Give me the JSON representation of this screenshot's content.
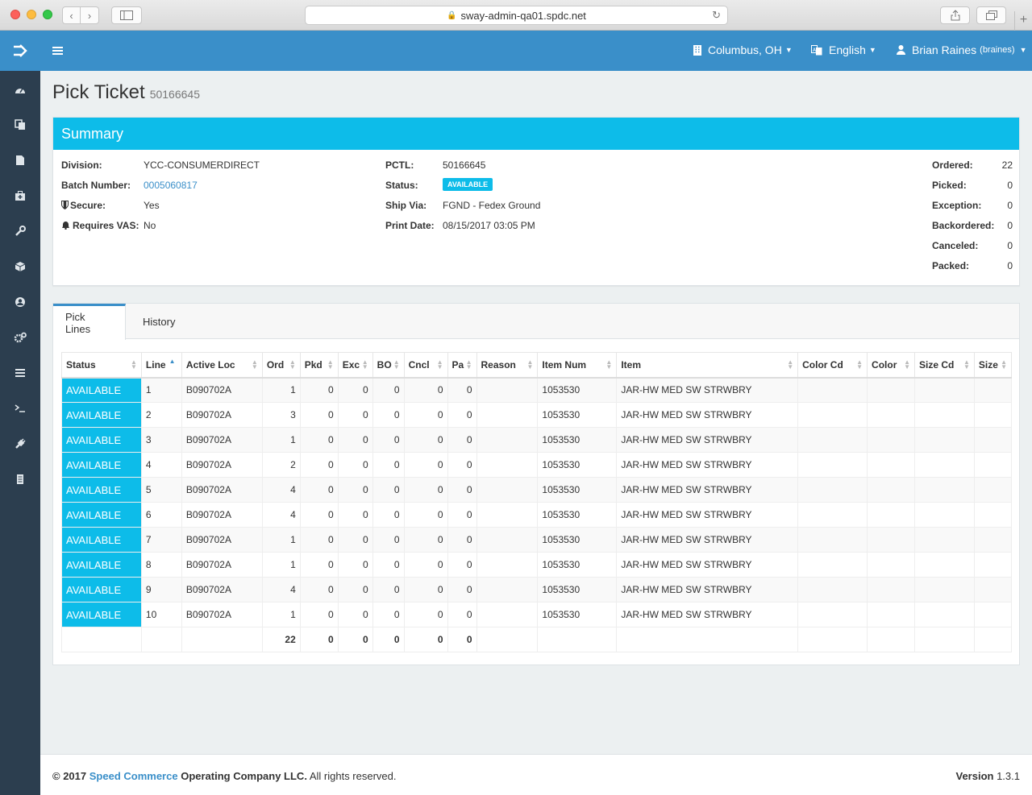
{
  "browser": {
    "url": "sway-admin-qa01.spdc.net"
  },
  "topnav": {
    "location": "Columbus, OH",
    "language": "English",
    "user_name": "Brian Raines",
    "user_login": "(braines)"
  },
  "page": {
    "title": "Pick Ticket",
    "ticket_id": "50166645"
  },
  "summary": {
    "heading": "Summary",
    "left": [
      {
        "label": "Division:",
        "value": "YCC-CONSUMERDIRECT"
      },
      {
        "label": "Batch Number:",
        "value": "0005060817"
      },
      {
        "label": "Secure:",
        "value": "Yes"
      },
      {
        "label": "Requires VAS:",
        "value": "No"
      }
    ],
    "middle": [
      {
        "label": "PCTL:",
        "value": "50166645"
      },
      {
        "label": "Status:",
        "value": "AVAILABLE"
      },
      {
        "label": "Ship Via:",
        "value": "FGND - Fedex Ground"
      },
      {
        "label": "Print Date:",
        "value": "08/15/2017 03:05 PM"
      }
    ],
    "right": [
      {
        "label": "Ordered:",
        "value": "22"
      },
      {
        "label": "Picked:",
        "value": "0"
      },
      {
        "label": "Exception:",
        "value": "0"
      },
      {
        "label": "Backordered:",
        "value": "0"
      },
      {
        "label": "Canceled:",
        "value": "0"
      },
      {
        "label": "Packed:",
        "value": "0"
      }
    ]
  },
  "tabs": [
    {
      "label": "Pick Lines",
      "active": true
    },
    {
      "label": "History",
      "active": false
    }
  ],
  "table": {
    "columns": [
      "Status",
      "Line",
      "Active Loc",
      "Ord",
      "Pkd",
      "Exc",
      "BO",
      "Cncl",
      "Pa",
      "Reason",
      "Item Num",
      "Item",
      "Color Cd",
      "Color",
      "Size Cd",
      "Size"
    ],
    "rows": [
      [
        "AVAILABLE",
        "1",
        "B090702A",
        "1",
        "0",
        "0",
        "0",
        "0",
        "0",
        "",
        "1053530",
        "JAR-HW MED SW STRWBRY",
        "",
        "",
        "",
        ""
      ],
      [
        "AVAILABLE",
        "2",
        "B090702A",
        "3",
        "0",
        "0",
        "0",
        "0",
        "0",
        "",
        "1053530",
        "JAR-HW MED SW STRWBRY",
        "",
        "",
        "",
        ""
      ],
      [
        "AVAILABLE",
        "3",
        "B090702A",
        "1",
        "0",
        "0",
        "0",
        "0",
        "0",
        "",
        "1053530",
        "JAR-HW MED SW STRWBRY",
        "",
        "",
        "",
        ""
      ],
      [
        "AVAILABLE",
        "4",
        "B090702A",
        "2",
        "0",
        "0",
        "0",
        "0",
        "0",
        "",
        "1053530",
        "JAR-HW MED SW STRWBRY",
        "",
        "",
        "",
        ""
      ],
      [
        "AVAILABLE",
        "5",
        "B090702A",
        "4",
        "0",
        "0",
        "0",
        "0",
        "0",
        "",
        "1053530",
        "JAR-HW MED SW STRWBRY",
        "",
        "",
        "",
        ""
      ],
      [
        "AVAILABLE",
        "6",
        "B090702A",
        "4",
        "0",
        "0",
        "0",
        "0",
        "0",
        "",
        "1053530",
        "JAR-HW MED SW STRWBRY",
        "",
        "",
        "",
        ""
      ],
      [
        "AVAILABLE",
        "7",
        "B090702A",
        "1",
        "0",
        "0",
        "0",
        "0",
        "0",
        "",
        "1053530",
        "JAR-HW MED SW STRWBRY",
        "",
        "",
        "",
        ""
      ],
      [
        "AVAILABLE",
        "8",
        "B090702A",
        "1",
        "0",
        "0",
        "0",
        "0",
        "0",
        "",
        "1053530",
        "JAR-HW MED SW STRWBRY",
        "",
        "",
        "",
        ""
      ],
      [
        "AVAILABLE",
        "9",
        "B090702A",
        "4",
        "0",
        "0",
        "0",
        "0",
        "0",
        "",
        "1053530",
        "JAR-HW MED SW STRWBRY",
        "",
        "",
        "",
        ""
      ],
      [
        "AVAILABLE",
        "10",
        "B090702A",
        "1",
        "0",
        "0",
        "0",
        "0",
        "0",
        "",
        "1053530",
        "JAR-HW MED SW STRWBRY",
        "",
        "",
        "",
        ""
      ]
    ],
    "totals": [
      "",
      "",
      "",
      "22",
      "0",
      "0",
      "0",
      "0",
      "0",
      "",
      "",
      "",
      "",
      "",
      "",
      ""
    ]
  },
  "footer": {
    "copyright_prefix": "© 2017",
    "company_link": "Speed Commerce",
    "company_rest": "Operating Company LLC.",
    "rights": "All rights reserved.",
    "version_label": "Version",
    "version": "1.3.1"
  },
  "colors": {
    "primary": "#3a8fc9",
    "accent": "#0dbce9",
    "sidebar": "#2c3e4f"
  },
  "icons": {
    "sidebar": [
      "dashboard-icon",
      "copy-icon",
      "file-icon",
      "medkit-icon",
      "wrench-icon",
      "cube-icon",
      "user-circle-icon",
      "cogs-icon",
      "list-icon",
      "terminal-icon",
      "plug-icon",
      "server-icon"
    ]
  }
}
